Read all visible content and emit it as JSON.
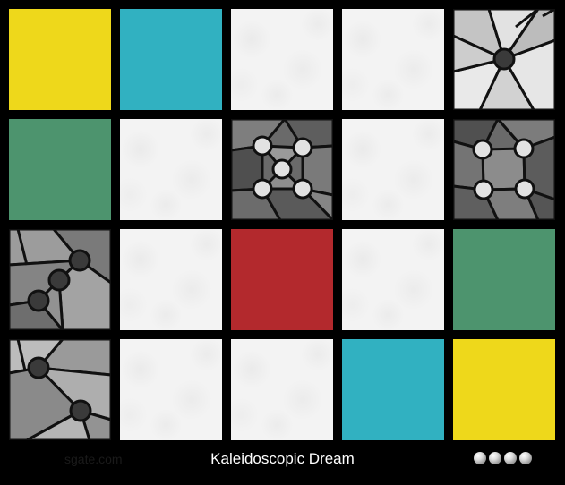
{
  "game": {
    "title": "Kaleidoscopic Dream",
    "brand": "sgate.com",
    "progress_dots": 4
  },
  "colors": {
    "yellow": "#eed81b",
    "teal": "#31b1c1",
    "green": "#4d946e",
    "red": "#b3292d",
    "paper": "#f3f3f3",
    "frame": "#000000"
  },
  "board": {
    "rows": 4,
    "cols": 5,
    "tiles": [
      {
        "kind": "solid",
        "color": "yellow"
      },
      {
        "kind": "solid",
        "color": "teal"
      },
      {
        "kind": "paper"
      },
      {
        "kind": "paper"
      },
      {
        "kind": "pattern",
        "pattern": "light-one-node"
      },
      {
        "kind": "solid",
        "color": "green"
      },
      {
        "kind": "paper"
      },
      {
        "kind": "pattern",
        "pattern": "dark-five-node"
      },
      {
        "kind": "paper"
      },
      {
        "kind": "pattern",
        "pattern": "dark-four-node"
      },
      {
        "kind": "pattern",
        "pattern": "mid-three-node"
      },
      {
        "kind": "paper"
      },
      {
        "kind": "solid",
        "color": "red"
      },
      {
        "kind": "paper"
      },
      {
        "kind": "solid",
        "color": "green"
      },
      {
        "kind": "pattern",
        "pattern": "mid-two-node"
      },
      {
        "kind": "paper"
      },
      {
        "kind": "paper"
      },
      {
        "kind": "solid",
        "color": "teal"
      },
      {
        "kind": "solid",
        "color": "yellow"
      }
    ]
  }
}
